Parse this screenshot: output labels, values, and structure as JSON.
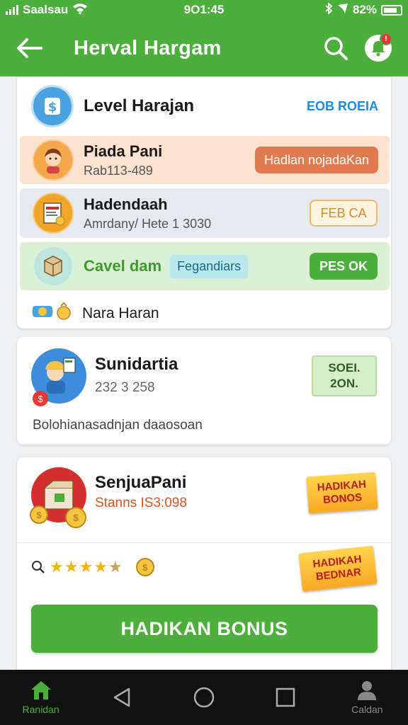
{
  "status_bar": {
    "carrier": "Saalsau",
    "time": "9O1:45",
    "battery": "82%"
  },
  "header": {
    "title": "Herval Hargam"
  },
  "level_card": {
    "title": "Level Harajan",
    "link": "EOB ROEIA"
  },
  "items": [
    {
      "title": "Piada Pani",
      "subtitle": "Rab113-489",
      "action": "Hadlan nojadaKan"
    },
    {
      "title": "Hadendaah",
      "subtitle": "Amrdany/ Hete 1 3030",
      "action": "FEB CA"
    },
    {
      "title": "Cavel dam",
      "tag": "Fegandiars",
      "action": "PES OK"
    }
  ],
  "nara": {
    "label": "Nara Haran"
  },
  "profile_card": {
    "name": "Sunidartia",
    "number": "232 3 258",
    "status_line1": "SOEI.",
    "status_line2": "2ON.",
    "description": "Bolohianasadnjan daaosoan"
  },
  "bonus_card": {
    "name": "SenjuaPani",
    "subtitle": "Stanns IS3:098",
    "sticker1_line1": "HADIKAH",
    "sticker1_line2": "BONOS",
    "sticker2_line1": "HADIKAH",
    "sticker2_line2": "BEDNAR",
    "button": "HADIKAN BONUS",
    "rating": 4.5,
    "rating_max": 5
  },
  "nav": {
    "home_label": "Ranidan",
    "profile_label": "Caldan"
  },
  "colors": {
    "primary": "#4caf3c",
    "orange_row": "#fbe3cf",
    "grey_row": "#e6e9ee",
    "green_row": "#dcf1d4",
    "link_blue": "#1e88e5"
  }
}
